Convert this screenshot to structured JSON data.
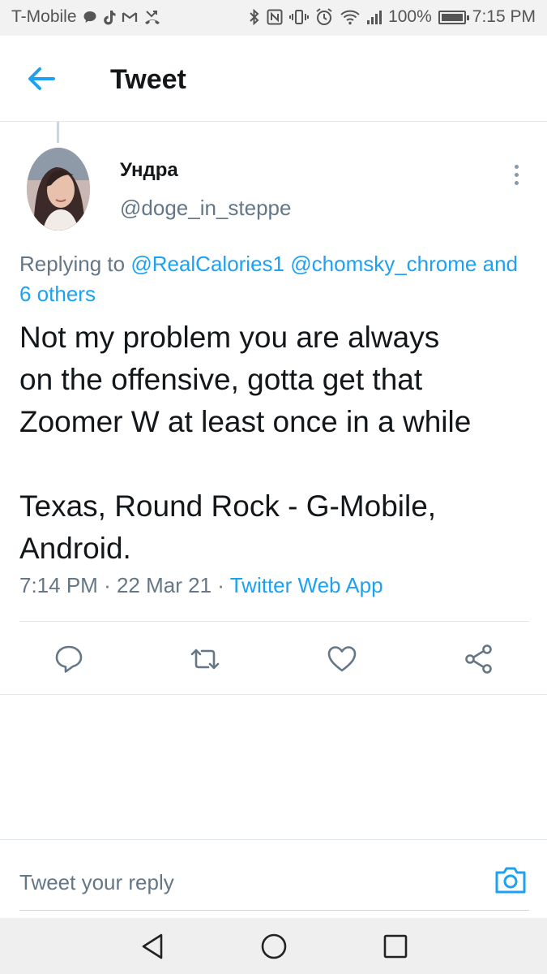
{
  "status_bar": {
    "carrier": "T-Mobile",
    "left_icons": [
      "chat-bubble-icon",
      "tiktok-icon",
      "gmail-icon",
      "missed-call-icon"
    ],
    "right_icons": [
      "bluetooth-icon",
      "nfc-icon",
      "vibrate-icon",
      "alarm-icon",
      "wifi-icon",
      "signal-icon",
      "battery-icon"
    ],
    "battery_level": 1.0,
    "battery": "100%",
    "time": "7:15 PM"
  },
  "header": {
    "title": "Tweet",
    "back_icon": "back-arrow-icon"
  },
  "tweet": {
    "display_name": "Ундра",
    "handle": "@doge_in_steppe",
    "replying_prefix": "Replying to",
    "replying_users": [
      "@RealCalories1",
      "@chomsky_chrome"
    ],
    "replying_others": "and 6 others",
    "text_lines": [
      "Not my problem you are always",
      "on the offensive, gotta get that",
      "Zoomer W at least once in a while",
      "",
      "Texas, Round Rock - G-Mobile,",
      "Android."
    ],
    "time": "7:14 PM",
    "separator": "·",
    "date": "22 Mar 21",
    "source": "Twitter Web App"
  },
  "actions": [
    "reply-icon",
    "retweet-icon",
    "like-icon",
    "share-icon"
  ],
  "reply_bar": {
    "placeholder": "Tweet your reply",
    "camera_icon": "camera-icon"
  },
  "nav_bar": [
    "back-triangle-icon",
    "home-circle-icon",
    "recents-square-icon"
  ],
  "colors": {
    "accent": "#1da1f2",
    "text_primary": "#14171a",
    "text_secondary": "#657786",
    "divider": "#e1e8ed",
    "status_bar_bg": "#f2f2f2",
    "nav_bar_bg": "#efefef"
  }
}
